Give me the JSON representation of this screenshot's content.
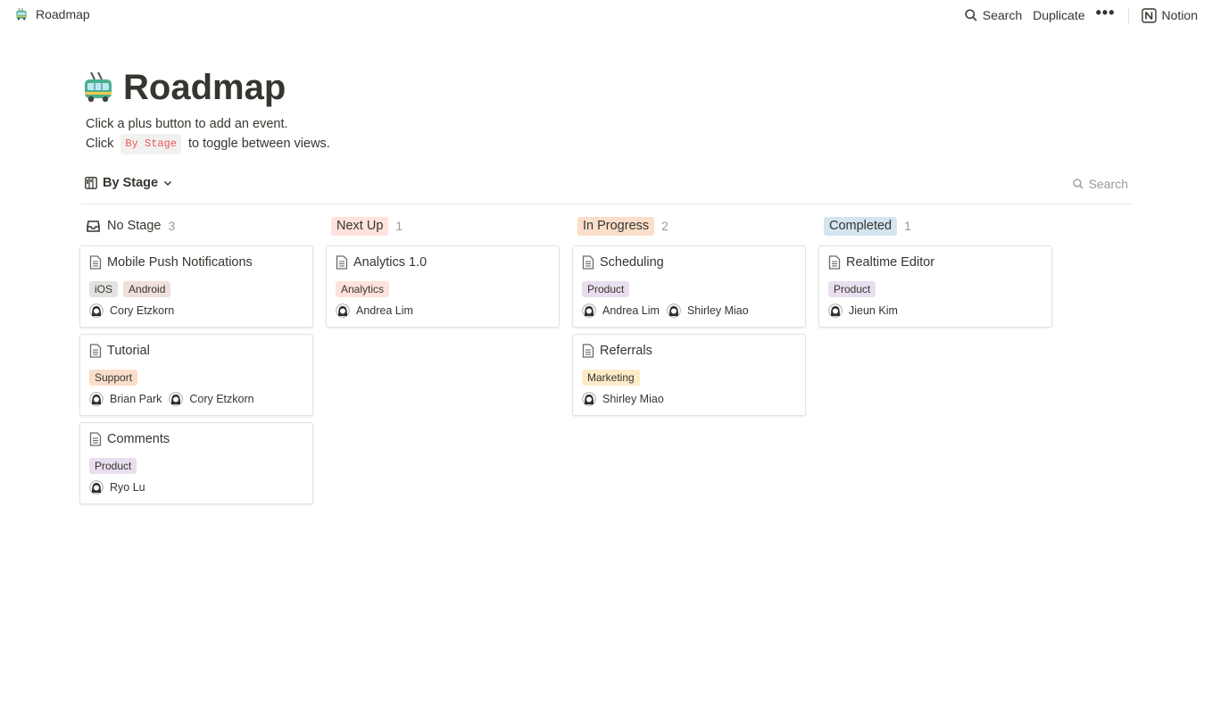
{
  "topbar": {
    "breadcrumb": "Roadmap",
    "search_label": "Search",
    "duplicate_label": "Duplicate",
    "more_label": "•••",
    "notion_label": "Notion"
  },
  "page": {
    "title": "Roadmap",
    "desc_line1": "Click a plus button to add an event.",
    "desc_line2_prefix": "Click",
    "desc_code": "By Stage",
    "desc_line2_suffix": "to toggle between views."
  },
  "view": {
    "name": "By Stage",
    "search_placeholder": "Search"
  },
  "colors": {
    "tag_gray": "#e3e2e0",
    "tag_brown": "#eee0da",
    "tag_red": "#ffe2dd",
    "tag_orange": "#fadec9",
    "tag_yellow": "#fdecc8",
    "tag_purple": "#e8deee",
    "tag_blue": "#d3e5ef"
  },
  "columns": [
    {
      "label": "No Stage",
      "count": "3",
      "cards": [
        {
          "title": "Mobile Push Notifications",
          "tags": [
            "iOS",
            "Android"
          ],
          "people": [
            "Cory Etzkorn"
          ]
        },
        {
          "title": "Tutorial",
          "tags": [
            "Support"
          ],
          "people": [
            "Brian Park",
            "Cory Etzkorn"
          ]
        },
        {
          "title": "Comments",
          "tags": [
            "Product"
          ],
          "people": [
            "Ryo Lu"
          ]
        }
      ]
    },
    {
      "label": "Next Up",
      "count": "1",
      "cards": [
        {
          "title": "Analytics 1.0",
          "tags": [
            "Analytics"
          ],
          "people": [
            "Andrea Lim"
          ]
        }
      ]
    },
    {
      "label": "In Progress",
      "count": "2",
      "cards": [
        {
          "title": "Scheduling",
          "tags": [
            "Product"
          ],
          "people": [
            "Andrea Lim",
            "Shirley Miao"
          ]
        },
        {
          "title": "Referrals",
          "tags": [
            "Marketing"
          ],
          "people": [
            "Shirley Miao"
          ]
        }
      ]
    },
    {
      "label": "Completed",
      "count": "1",
      "cards": [
        {
          "title": "Realtime Editor",
          "tags": [
            "Product"
          ],
          "people": [
            "Jieun Kim"
          ]
        }
      ]
    }
  ]
}
